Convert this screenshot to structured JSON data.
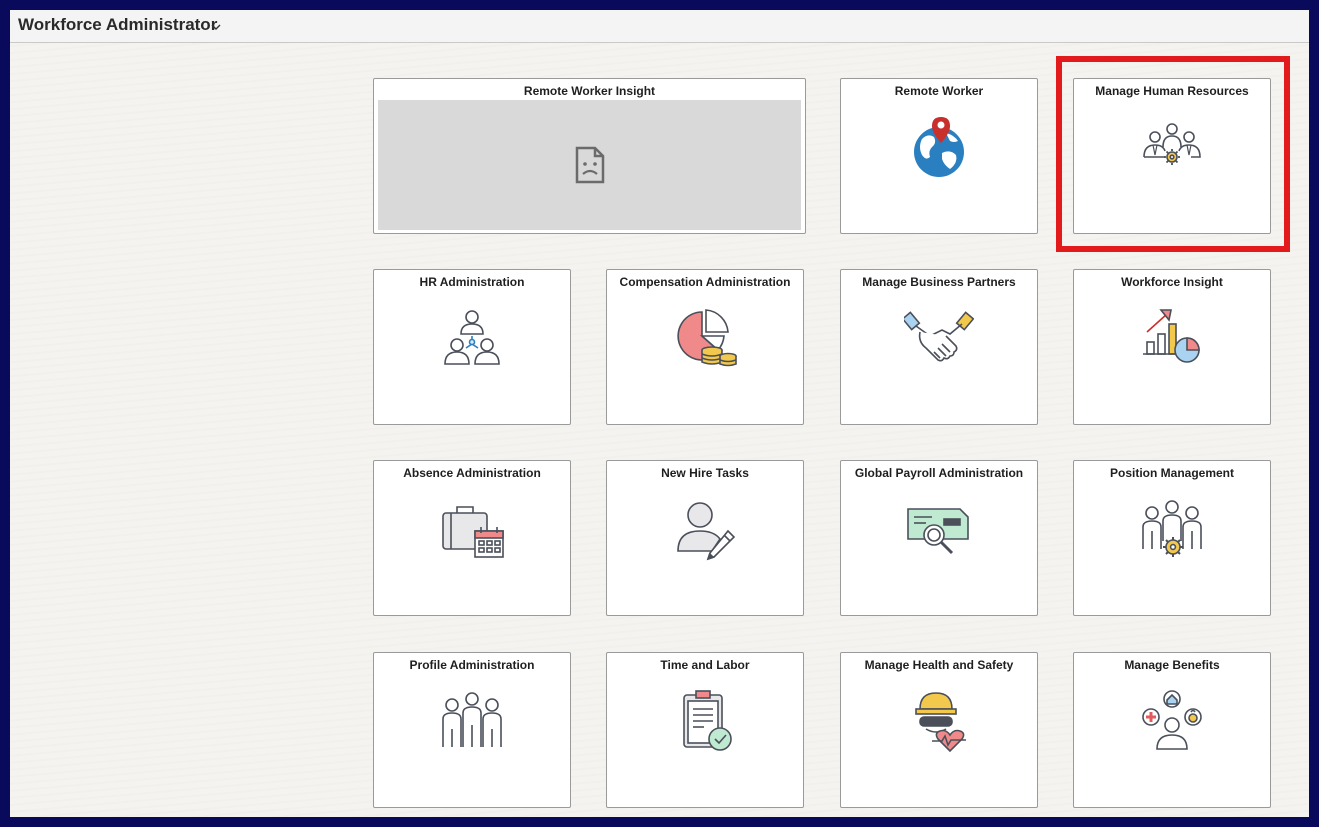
{
  "header": {
    "title": "Workforce Administrator"
  },
  "tiles": [
    {
      "label": "Remote Worker Insight"
    },
    {
      "label": "Remote Worker"
    },
    {
      "label": "Manage Human Resources"
    },
    {
      "label": "HR Administration"
    },
    {
      "label": "Compensation Administration"
    },
    {
      "label": "Manage Business Partners"
    },
    {
      "label": "Workforce Insight"
    },
    {
      "label": "Absence Administration"
    },
    {
      "label": "New Hire Tasks"
    },
    {
      "label": "Global Payroll Administration"
    },
    {
      "label": "Position Management"
    },
    {
      "label": "Profile Administration"
    },
    {
      "label": "Time and Labor"
    },
    {
      "label": "Manage Health and Safety"
    },
    {
      "label": "Manage Benefits"
    }
  ],
  "icons": {
    "remote_worker_insight": "broken-image-icon",
    "remote_worker": "globe-pin-icon",
    "manage_hr": "people-gear-icon",
    "hr_admin": "org-people-icon",
    "comp_admin": "pie-coins-icon",
    "business_partners": "handshake-icon",
    "workforce_insight": "growth-chart-icon",
    "absence_admin": "briefcase-calendar-icon",
    "new_hire": "person-pencil-icon",
    "global_payroll": "check-magnifier-icon",
    "position_mgmt": "team-gear-icon",
    "profile_admin": "team-people-icon",
    "time_labor": "clipboard-check-icon",
    "health_safety": "hardhat-heart-icon",
    "benefits": "person-benefits-icon"
  },
  "colors": {
    "highlight": "#e31a1c",
    "frame_border": "#0a0a5c",
    "icon_stroke": "#4a4f5a"
  }
}
